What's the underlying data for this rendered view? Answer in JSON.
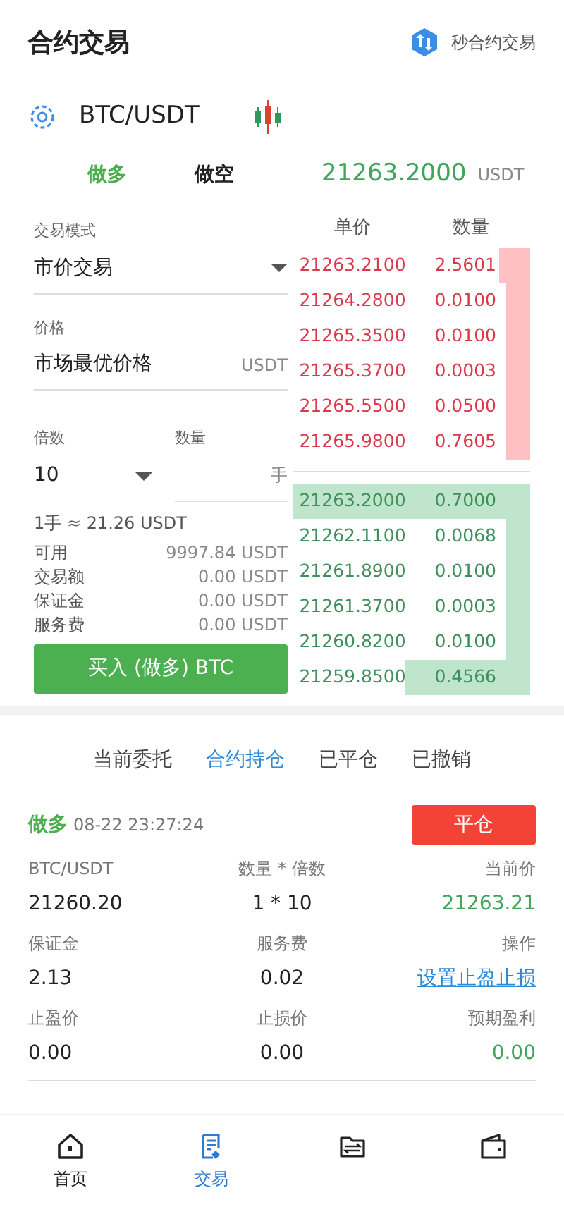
{
  "header": {
    "title": "合约交易",
    "link": "秒合约交易"
  },
  "pair": {
    "symbol": "BTC/USDT"
  },
  "sides": [
    {
      "label": "做多",
      "selected": true
    },
    {
      "label": "做空",
      "selected": false
    }
  ],
  "last_price": {
    "value": "21263.2000",
    "unit": "USDT"
  },
  "form": {
    "mode_label": "交易模式",
    "mode_value": "市价交易",
    "price_label": "价格",
    "price_value": "市场最优价格",
    "price_unit": "USDT",
    "leverage_label": "倍数",
    "leverage_value": "10",
    "qty_label": "数量",
    "qty_unit": "手",
    "lot_note": "1手 ≈ 21.26 USDT",
    "stats": [
      {
        "label": "可用",
        "value": "9997.84 USDT"
      },
      {
        "label": "交易额",
        "value": "0.00 USDT"
      },
      {
        "label": "保证金",
        "value": "0.00 USDT"
      },
      {
        "label": "服务费",
        "value": "0.00 USDT"
      }
    ],
    "submit": "买入 (做多) BTC"
  },
  "order_book": {
    "columns": [
      "单价",
      "数量"
    ],
    "asks": [
      {
        "price": "21263.2100",
        "amount": "2.5601"
      },
      {
        "price": "21264.2800",
        "amount": "0.0100"
      },
      {
        "price": "21265.3500",
        "amount": "0.0100"
      },
      {
        "price": "21265.3700",
        "amount": "0.0003"
      },
      {
        "price": "21265.5500",
        "amount": "0.0500"
      },
      {
        "price": "21265.9800",
        "amount": "0.7605"
      }
    ],
    "bids": [
      {
        "price": "21263.2000",
        "amount": "0.7000"
      },
      {
        "price": "21262.1100",
        "amount": "0.0068"
      },
      {
        "price": "21261.8900",
        "amount": "0.0100"
      },
      {
        "price": "21261.3700",
        "amount": "0.0003"
      },
      {
        "price": "21260.8200",
        "amount": "0.0100"
      },
      {
        "price": "21259.8500",
        "amount": "0.4566"
      }
    ]
  },
  "position_tabs": [
    {
      "label": "当前委托",
      "selected": false
    },
    {
      "label": "合约持仓",
      "selected": true
    },
    {
      "label": "已平仓",
      "selected": false
    },
    {
      "label": "已撤销",
      "selected": false
    }
  ],
  "position": {
    "side": "做多",
    "time": "08-22 23:27:24",
    "close_button": "平仓",
    "fields": [
      {
        "label": "BTC/USDT",
        "value": "21260.20",
        "kind": "text"
      },
      {
        "label": "数量 * 倍数",
        "value": "1 * 10",
        "kind": "text"
      },
      {
        "label": "当前价",
        "value": "21263.21",
        "kind": "gain"
      },
      {
        "label": "保证金",
        "value": "2.13",
        "kind": "text"
      },
      {
        "label": "服务费",
        "value": "0.02",
        "kind": "text"
      },
      {
        "label": "操作",
        "value": "设置止盈止损",
        "kind": "link"
      },
      {
        "label": "止盈价",
        "value": "0.00",
        "kind": "text"
      },
      {
        "label": "止损价",
        "value": "0.00",
        "kind": "text"
      },
      {
        "label": "预期盈利",
        "value": "0.00",
        "kind": "gain"
      }
    ]
  },
  "bottom_nav": [
    {
      "label": "首页",
      "kind": "home",
      "selected": false
    },
    {
      "label": "交易",
      "kind": "trade",
      "selected": true
    },
    {
      "kind": "exchange",
      "selected": false
    },
    {
      "kind": "wallet",
      "selected": false
    }
  ]
}
